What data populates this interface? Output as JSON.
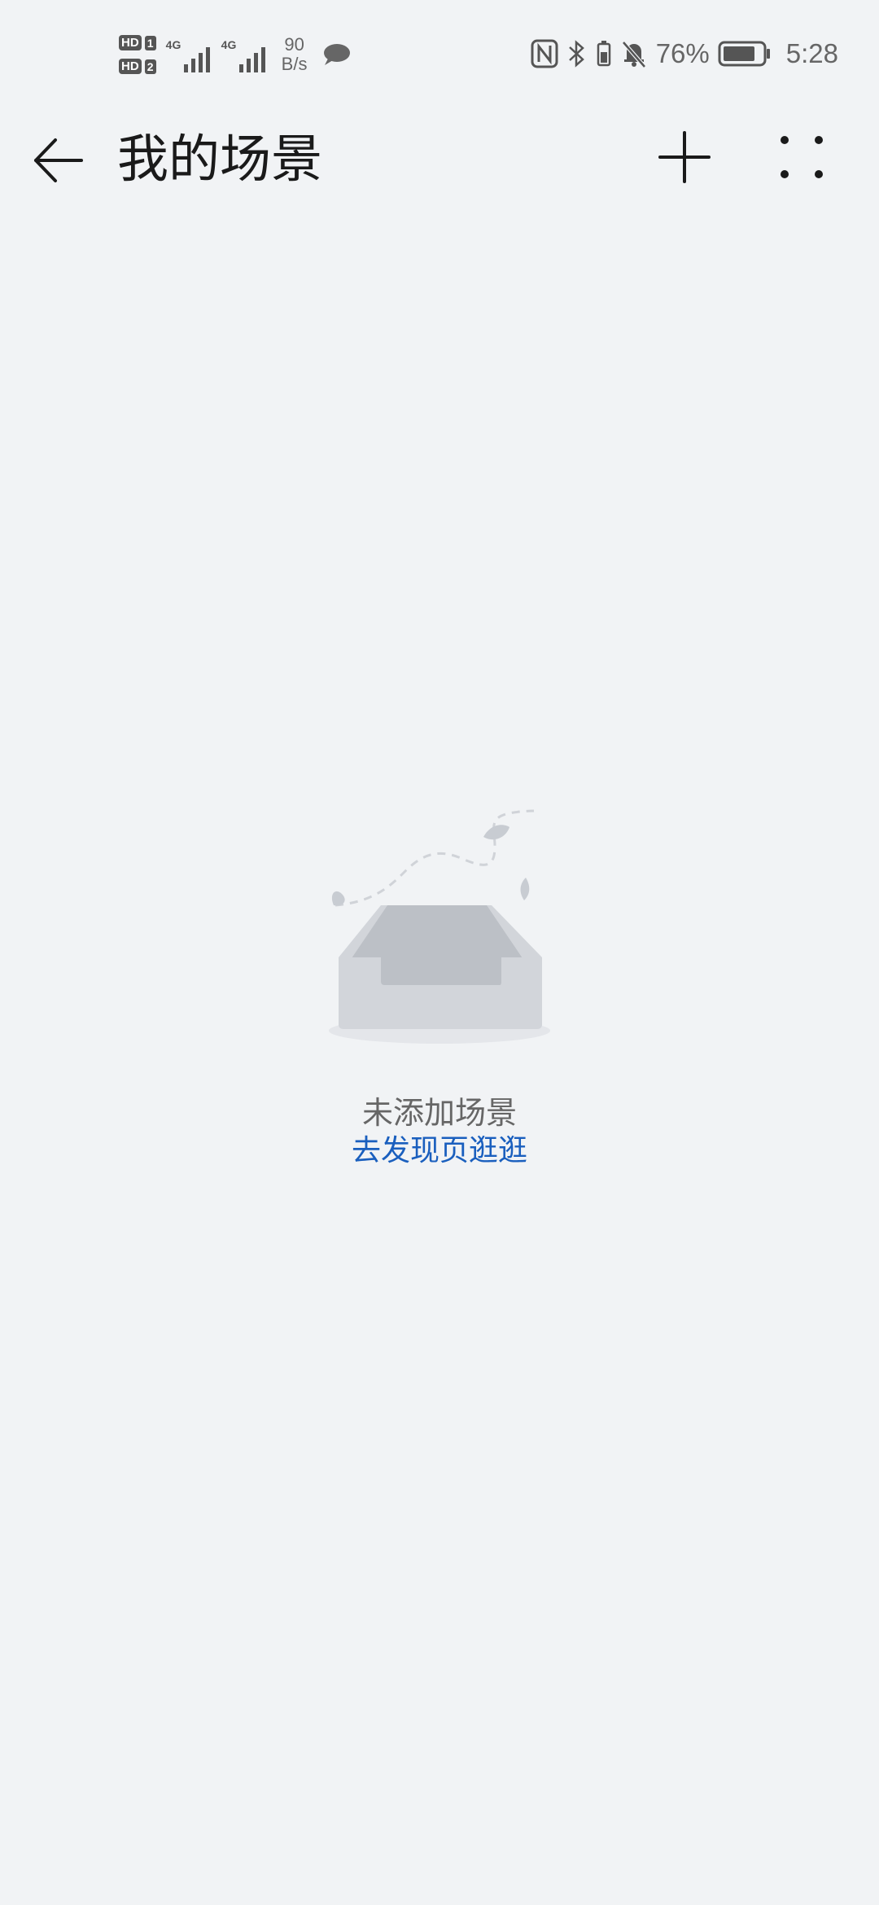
{
  "status_bar": {
    "sim1_badge": "HD",
    "sim1_number": "1",
    "sim2_badge": "HD",
    "sim2_number": "2",
    "net1_label": "4G",
    "net2_label": "4G",
    "speed_value": "90",
    "speed_unit": "B/s",
    "battery_percent": "76%",
    "time": "5:28"
  },
  "app_bar": {
    "title": "我的场景"
  },
  "empty_state": {
    "message": "未添加场景",
    "link_text": "去发现页逛逛"
  },
  "colors": {
    "background": "#f1f3f5",
    "link": "#1a5fbe",
    "title": "#1a1a1a"
  }
}
